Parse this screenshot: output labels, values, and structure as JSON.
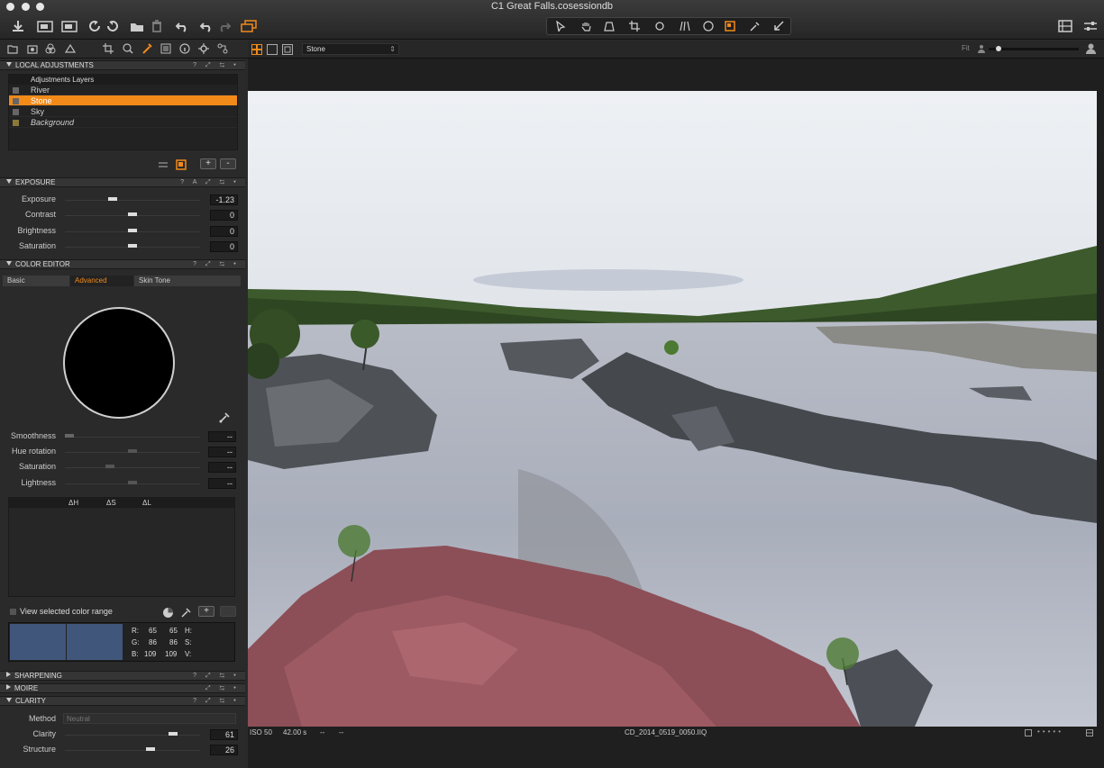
{
  "window": {
    "title": "C1 Great Falls.cosessiondb"
  },
  "toolbar": {
    "fit_label": "Fit"
  },
  "viewer": {
    "variant_select": "Stone",
    "filename": "CD_2014_0519_0050.IIQ",
    "iso": "ISO 50",
    "shutter": "42.00 s",
    "aperture": "--",
    "focal": "--"
  },
  "local_adjustments": {
    "title": "LOCAL ADJUSTMENTS",
    "header": "Adjustments Layers",
    "layers": [
      {
        "label": "River",
        "selected": false
      },
      {
        "label": "Stone",
        "selected": true
      },
      {
        "label": "Sky",
        "selected": false
      },
      {
        "label": "Background",
        "selected": false
      }
    ],
    "add_label": "+",
    "remove_label": "-"
  },
  "exposure": {
    "title": "EXPOSURE",
    "rows": [
      {
        "label": "Exposure",
        "value": "-1.23"
      },
      {
        "label": "Contrast",
        "value": "0"
      },
      {
        "label": "Brightness",
        "value": "0"
      },
      {
        "label": "Saturation",
        "value": "0"
      }
    ]
  },
  "color_editor": {
    "title": "COLOR EDITOR",
    "tabs": [
      "Basic",
      "Advanced",
      "Skin Tone"
    ],
    "active_tab": "Advanced",
    "rows": [
      {
        "label": "Smoothness",
        "value": "--"
      },
      {
        "label": "Hue rotation",
        "value": "--"
      },
      {
        "label": "Saturation",
        "value": "--"
      },
      {
        "label": "Lightness",
        "value": "--"
      }
    ],
    "delta_h": "ΔH",
    "delta_s": "ΔS",
    "delta_l": "ΔL",
    "view_selected": "View selected color range",
    "readout": {
      "r_label": "R:",
      "r1": "65",
      "r2": "65",
      "h_label": "H:",
      "g_label": "G:",
      "g1": "86",
      "g2": "86",
      "s_label": "S:",
      "b_label": "B:",
      "b1": "109",
      "b2": "109",
      "v_label": "V:"
    },
    "swatch_color": "#41567b"
  },
  "sharpening": {
    "title": "SHARPENING"
  },
  "moire": {
    "title": "MOIRE"
  },
  "clarity": {
    "title": "CLARITY",
    "method_label": "Method",
    "method_value": "Neutral",
    "rows": [
      {
        "label": "Clarity",
        "value": "61"
      },
      {
        "label": "Structure",
        "value": "26"
      }
    ]
  },
  "colors": {
    "accent": "#f28a1a"
  }
}
